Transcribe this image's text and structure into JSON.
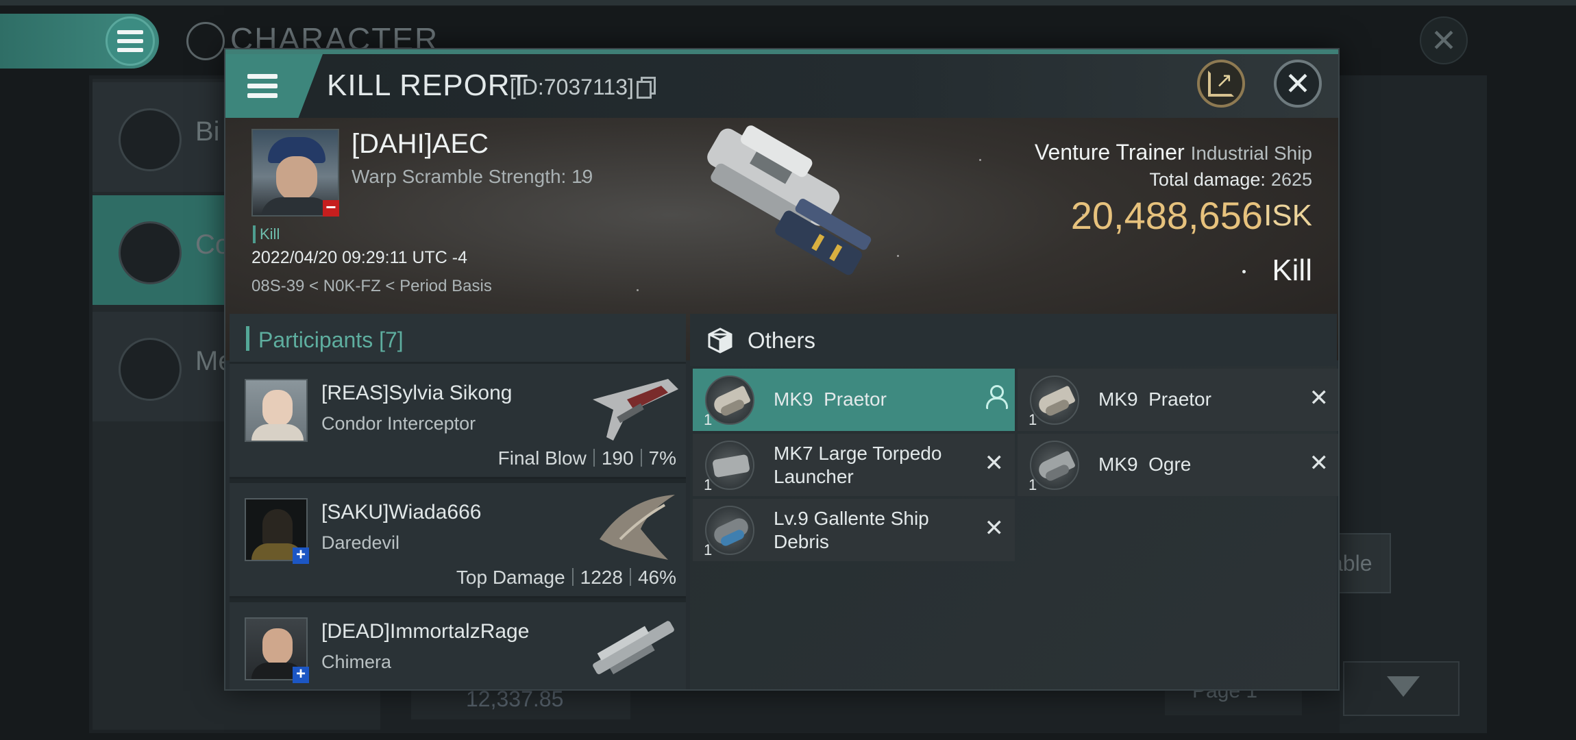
{
  "background": {
    "title": "CHARACTER",
    "side_items": [
      {
        "label": "Bi",
        "icon": "hamburger-icon"
      },
      {
        "label": "Co",
        "icon": "crossed-swords-icon"
      },
      {
        "label": "Me",
        "icon": "star-badge-icon"
      }
    ],
    "button_fragment": "able",
    "page_label": "Page 1",
    "bottom_value": "12,337.85"
  },
  "window": {
    "title": "KILL REPORT",
    "id_text": "[ID:7037113]",
    "accent_color": "#3d867c"
  },
  "victim": {
    "name": "[DAHI]AEC",
    "warp_scramble": "Warp Scramble Strength: 19",
    "kill_tag": "Kill",
    "datetime": "2022/04/20 09:29:11 UTC -4",
    "location": "08S-39 < N0K-FZ < Period Basis",
    "ship_name": "Venture Trainer",
    "ship_class": "Industrial Ship",
    "total_damage_label": "Total damage:",
    "total_damage": "2625",
    "isk_value": "20,488,656",
    "isk_unit": "ISK",
    "result": "Kill"
  },
  "participants": {
    "header": "Participants [7]",
    "rows": [
      {
        "name": "[REAS]Sylvia Sikong",
        "ship": "Condor Interceptor",
        "stat_label": "Final Blow",
        "damage": "190",
        "percent": "7%",
        "badge": ""
      },
      {
        "name": "[SAKU]Wiada666",
        "ship": "Daredevil",
        "stat_label": "Top Damage",
        "damage": "1228",
        "percent": "46%",
        "badge": "+"
      },
      {
        "name": "[DEAD]ImmortalzRage",
        "ship": "Chimera",
        "stat_label": "",
        "damage": "",
        "percent": "",
        "badge": "+"
      }
    ]
  },
  "others": {
    "title": "Others",
    "items": [
      {
        "name": "MK9  Praetor",
        "qty": "1",
        "action": "person-icon",
        "selected": true
      },
      {
        "name": "MK9  Praetor",
        "qty": "1",
        "action": "close-icon",
        "selected": false
      },
      {
        "name": "MK7 Large Torpedo Launcher",
        "qty": "1",
        "action": "close-icon",
        "selected": false
      },
      {
        "name": "MK9  Ogre",
        "qty": "1",
        "action": "close-icon",
        "selected": false
      },
      {
        "name": "Lv.9 Gallente Ship Debris",
        "qty": "1",
        "action": "close-icon",
        "selected": false
      }
    ]
  },
  "colors": {
    "accent": "#3d867c",
    "isk": "#e7c27d",
    "negative_badge": "#c61e1e",
    "positive_badge": "#1c56c4"
  }
}
